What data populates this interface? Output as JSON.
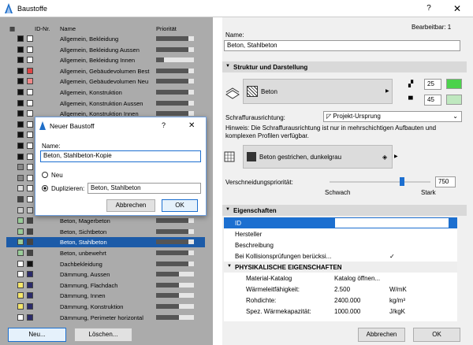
{
  "window": {
    "title": "Baustoffe",
    "help": "?",
    "close": "✕"
  },
  "list": {
    "headers": {
      "id": "ID-Nr.",
      "name": "Name",
      "priority": "Priorität"
    },
    "rows": [
      {
        "name": "Allgemein, Bekleidung",
        "c1": "#111111",
        "c2": "#ffffff",
        "p": 0.85
      },
      {
        "name": "Allgemein, Bekleidung Aussen",
        "c1": "#111111",
        "c2": "#ffffff",
        "p": 0.85
      },
      {
        "name": "Allgemein, Bekleidung Innen",
        "c1": "#111111",
        "c2": "#ffffff",
        "p": 0.2
      },
      {
        "name": "Allgemein, Gebäudevolumen Best",
        "c1": "#111111",
        "c2": "#d44",
        "p": 0.85
      },
      {
        "name": "Allgemein, Gebäudevolumen Neu",
        "c1": "#111111",
        "c2": "#e88",
        "p": 0.85
      },
      {
        "name": "Allgemein, Konstruktion",
        "c1": "#111111",
        "c2": "#ffffff",
        "p": 0.85
      },
      {
        "name": "Allgemein, Konstruktion Aussen",
        "c1": "#111111",
        "c2": "#ffffff",
        "p": 0.85
      },
      {
        "name": "Allgemein, Konstruktion Innen",
        "c1": "#111111",
        "c2": "#ffffff",
        "p": 0.85
      },
      {
        "name": "",
        "c1": "#111111",
        "c2": "#ffffff",
        "p": 0.85
      },
      {
        "name": "",
        "c1": "#111111",
        "c2": "#ffffff",
        "p": 0.85
      },
      {
        "name": "",
        "c1": "#111111",
        "c2": "#ffffff",
        "p": 0.85
      },
      {
        "name": "",
        "c1": "#111111",
        "c2": "#ffffff",
        "p": 0.85
      },
      {
        "name": "",
        "c1": "#888888",
        "c2": "#ffffff",
        "p": 0.85
      },
      {
        "name": "",
        "c1": "#888888",
        "c2": "#ffffff",
        "p": 0.85
      },
      {
        "name": "",
        "c1": "#dddddd",
        "c2": "#ffffff",
        "p": 0.85
      },
      {
        "name": "",
        "c1": "#444444",
        "c2": "#ffffff",
        "p": 0.85
      },
      {
        "name": "",
        "c1": "#cccccc",
        "c2": "#cccccc",
        "p": 0.85
      },
      {
        "name": "Beton, Magerbeton",
        "c1": "#9c9",
        "c2": "#444444",
        "p": 0.85
      },
      {
        "name": "Beton, Sichtbeton",
        "c1": "#9c9",
        "c2": "#444444",
        "p": 0.85
      },
      {
        "name": "Beton, Stahlbeton",
        "c1": "#9c9",
        "c2": "#444444",
        "p": 0.85,
        "sel": true
      },
      {
        "name": "Beton, unbewehrt",
        "c1": "#9c9",
        "c2": "#444444",
        "p": 0.85
      },
      {
        "name": "Dachbekleidung",
        "c1": "#ffffff",
        "c2": "#111111",
        "p": 0.85
      },
      {
        "name": "Dämmung, Aussen",
        "c1": "#ffffff",
        "c2": "#2a2a6a",
        "p": 0.6
      },
      {
        "name": "Dämmung, Flachdach",
        "c1": "#f5e66a",
        "c2": "#2a2a6a",
        "p": 0.6
      },
      {
        "name": "Dämmung, Innen",
        "c1": "#f5e66a",
        "c2": "#2a2a6a",
        "p": 0.6
      },
      {
        "name": "Dämmung, Konstruktion",
        "c1": "#f5e66a",
        "c2": "#2a2a6a",
        "p": 0.6
      },
      {
        "name": "Dämmung, Perimeter horizontal",
        "c1": "#ffffff",
        "c2": "#2a2a6a",
        "p": 0.6
      }
    ]
  },
  "buttons": {
    "new": "Neu...",
    "delete": "Löschen...",
    "cancel": "Abbrechen",
    "ok": "OK"
  },
  "dialog": {
    "title": "Neuer Baustoff",
    "help": "?",
    "close": "✕",
    "name_label": "Name:",
    "name_value": "Beton, Stahlbeton-Kopie",
    "opt_new": "Neu",
    "opt_dup": "Duplizieren:",
    "dup_value": "Beton, Stahlbeton",
    "cancel": "Abbrechen",
    "ok": "OK"
  },
  "right": {
    "editable": "Bearbeitbar: 1",
    "name_label": "Name:",
    "name_value": "Beton, Stahlbeton",
    "sec_struct": "Struktur und Darstellung",
    "hatch": "Beton",
    "pen1": "25",
    "pen2": "45",
    "orient_label": "Schraffurausrichtung:",
    "orient_value": "Projekt-Ursprung",
    "hint": "Hinweis: Die Schraffurausrichtung ist nur in mehrschichtigen Aufbauten und komplexen Profilen verfügbar.",
    "surface": "Beton gestrichen, dunkelgrau",
    "prio_label": "Verschneidungspriorität:",
    "prio_value": "750",
    "prio_level": 0.72,
    "weak": "Schwach",
    "strong": "Stark",
    "sec_props": "Eigenschaften",
    "props": [
      {
        "k": "ID",
        "v": "",
        "sel": true
      },
      {
        "k": "Hersteller",
        "v": ""
      },
      {
        "k": "Beschreibung",
        "v": ""
      },
      {
        "k": "Bei Kollisionsprüfungen berücksi...",
        "v": "✓"
      }
    ],
    "phys_head": "PHYSIKALISCHE EIGENSCHAFTEN",
    "phys": [
      {
        "k": "Material-Katalog",
        "v": "Katalog öffnen...",
        "u": ""
      },
      {
        "k": "Wärmeleitfähigkeit:",
        "v": "2.500",
        "u": "W/mK"
      },
      {
        "k": "Rohdichte:",
        "v": "2400.000",
        "u": "kg/m³"
      },
      {
        "k": "Spez. Wärmekapazität:",
        "v": "1000.000",
        "u": "J/kgK"
      }
    ]
  }
}
